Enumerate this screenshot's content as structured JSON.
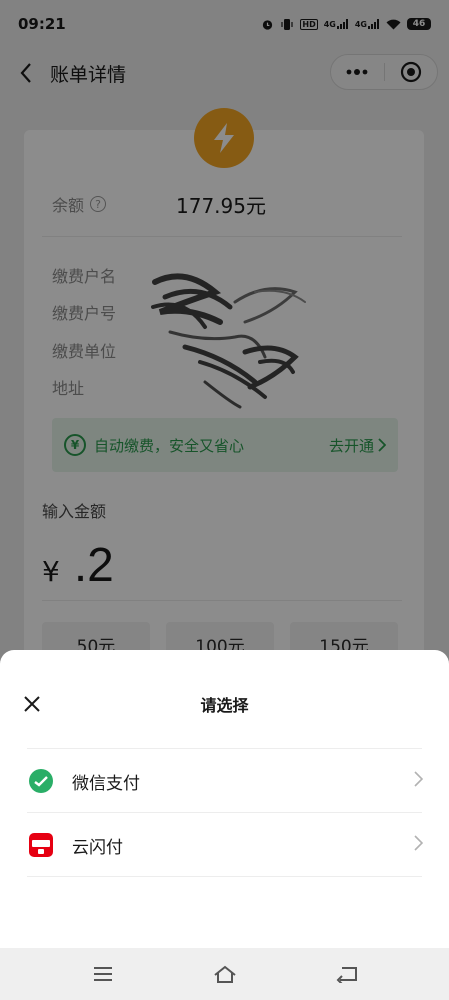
{
  "status_bar": {
    "time": "09:21",
    "net_1": "4G",
    "net_2": "4G",
    "hd": "HD",
    "battery": "46"
  },
  "nav": {
    "title": "账单详情"
  },
  "card": {
    "balance_label": "余额",
    "balance_value": "177.95元",
    "info_labels": [
      "缴费户名",
      "缴费户号",
      "缴费单位",
      "地址"
    ],
    "auto_pay_text": "自动缴费，安全又省心",
    "auto_pay_link": "去开通",
    "amount_label": "输入金额",
    "currency": "¥",
    "amount_value": ".2",
    "quick_amounts": [
      "50元",
      "100元",
      "150元"
    ]
  },
  "sheet": {
    "title": "请选择",
    "options": [
      {
        "label": "微信支付",
        "icon": "wechat-pay-icon"
      },
      {
        "label": "云闪付",
        "icon": "unionpay-icon"
      }
    ]
  },
  "colors": {
    "bolt": "#f5a623",
    "green": "#2a9a4e",
    "wechat": "#2aae67",
    "unionpay": "#e60012"
  }
}
